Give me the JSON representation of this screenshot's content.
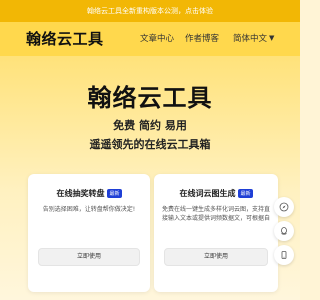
{
  "announcement": {
    "text": "翰络云工具全新重构版本公测，点击体验"
  },
  "navbar": {
    "logo": "翰络云工具",
    "links": [
      {
        "label": "文章中心"
      },
      {
        "label": "作者博客"
      }
    ],
    "language": {
      "label": "简体中文",
      "icon": "chevron-down-icon"
    }
  },
  "hero": {
    "title": "翰络云工具",
    "slogan": "免费 简约 易用",
    "subtitle": "遥遥领先的在线云工具箱"
  },
  "cards": [
    {
      "title": "在线抽奖转盘",
      "badge": "最新",
      "description": "告别选择困难，让转盘帮你做决定!",
      "button": "立即使用"
    },
    {
      "title": "在线词云图生成",
      "badge": "最新",
      "description": "免费在线一键生成多样化词云图，支持直接输入文本或提供词频数据文，可根据自",
      "button": "立即使用"
    }
  ],
  "side_tools": [
    {
      "icon": "compass-icon"
    },
    {
      "icon": "qq-icon"
    },
    {
      "icon": "mobile-icon"
    }
  ],
  "colors": {
    "announcement_bg": "#f2b705",
    "navbar_bg": "#ffd84d",
    "badge_bg": "#1f3fd6"
  }
}
